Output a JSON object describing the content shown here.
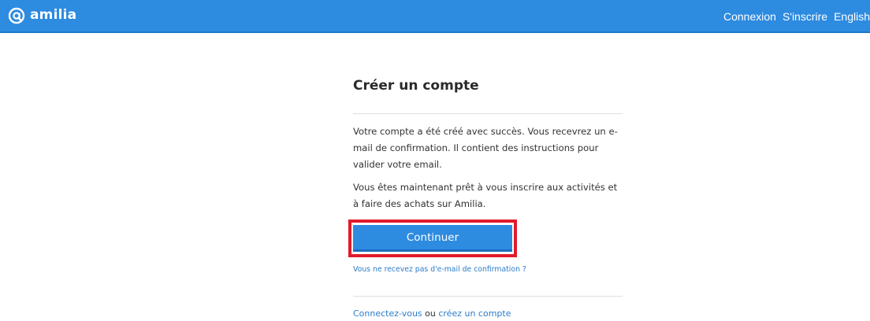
{
  "header": {
    "logo_text": "amilia",
    "logo_icon": "amilia-logo-icon",
    "nav": {
      "login": "Connexion",
      "signup": "S'inscrire",
      "language": "English"
    },
    "bar_color": "#2d8be0"
  },
  "main": {
    "title": "Créer un compte",
    "message_1": "Votre compte a été créé avec succès. Vous recevrez un e-mail de confirmation. Il contient des instructions pour valider votre email.",
    "message_2": "Vous êtes maintenant prêt à vous inscrire aux activités et à faire des achats sur Amilia.",
    "continue_label": "Continuer",
    "resend_link": "Vous ne recevez pas d'e-mail de confirmation ?"
  },
  "footer": {
    "login_link": "Connectez-vous",
    "separator": " ou ",
    "create_link": "créez un compte"
  },
  "colors": {
    "accent": "#2d8be0",
    "link": "#2d7cc9",
    "highlight": "#e11b2b"
  }
}
